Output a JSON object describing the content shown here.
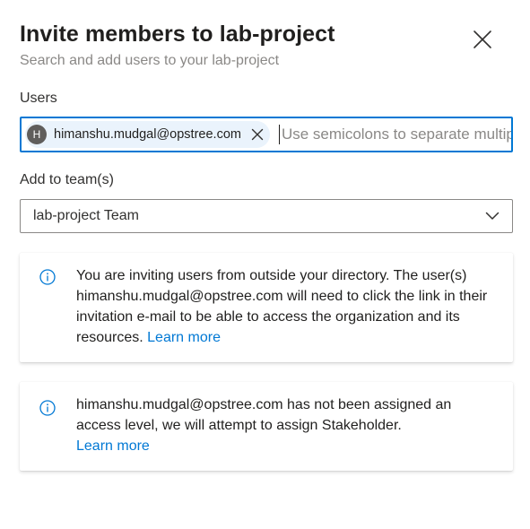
{
  "dialog": {
    "title": "Invite members to lab-project",
    "subtitle": "Search and add users to your lab-project",
    "close_icon": "close-icon"
  },
  "users": {
    "label": "Users",
    "chip": {
      "avatar_initial": "H",
      "email": "himanshu.mudgal@opstree.com",
      "remove_icon": "close-icon"
    },
    "placeholder": "Use semicolons to separate multiple users"
  },
  "team": {
    "label": "Add to team(s)",
    "selected": "lab-project Team",
    "chevron_icon": "chevron-down-icon"
  },
  "notices": [
    {
      "icon": "info-icon",
      "text": "You are inviting users from outside your directory. The user(s) himanshu.mudgal@opstree.com will need to click the link in their invitation e-mail to be able to access the organization and its resources.",
      "link": "Learn more"
    },
    {
      "icon": "info-icon",
      "text": "himanshu.mudgal@opstree.com has not been assigned an access level, we will attempt to assign Stakeholder.",
      "link": "Learn more"
    }
  ],
  "colors": {
    "accent": "#0078d4",
    "chip_bg": "#eaf3fc",
    "avatar_bg": "#605e5c",
    "subtle_text": "#8a8886"
  }
}
